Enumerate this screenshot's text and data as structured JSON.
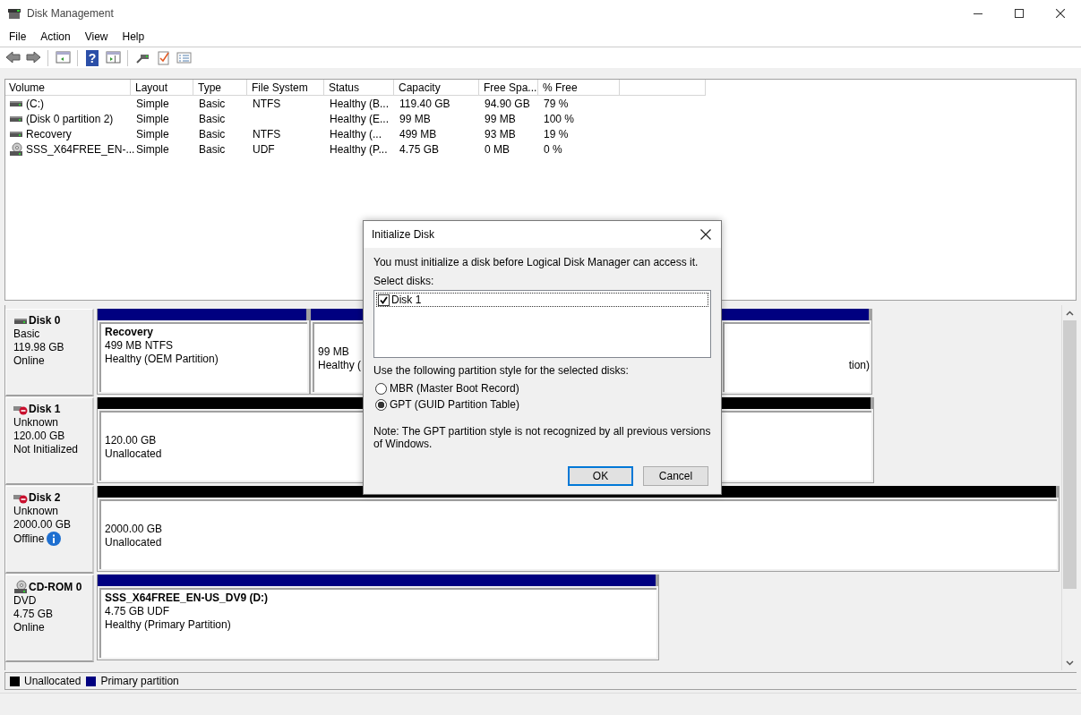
{
  "window": {
    "title": "Disk Management"
  },
  "toolbar": {
    "help_glyph": "?"
  },
  "menu": [
    "File",
    "Action",
    "View",
    "Help"
  ],
  "volumes": {
    "columns": [
      "Volume",
      "Layout",
      "Type",
      "File System",
      "Status",
      "Capacity",
      "Free Spa...",
      "% Free"
    ],
    "rows": [
      {
        "kind": "drive",
        "cells": [
          "(C:)",
          "Simple",
          "Basic",
          "NTFS",
          "Healthy (B...",
          "119.40 GB",
          "94.90 GB",
          "79 %"
        ]
      },
      {
        "kind": "drive",
        "cells": [
          "(Disk 0 partition 2)",
          "Simple",
          "Basic",
          "",
          "Healthy (E...",
          "99 MB",
          "99 MB",
          "100 %"
        ]
      },
      {
        "kind": "drive",
        "cells": [
          "Recovery",
          "Simple",
          "Basic",
          "NTFS",
          "Healthy (...",
          "499 MB",
          "93 MB",
          "19 %"
        ]
      },
      {
        "kind": "optical",
        "cells": [
          "SSS_X64FREE_EN-...",
          "Simple",
          "Basic",
          "UDF",
          "Healthy (P...",
          "4.75 GB",
          "0 MB",
          "0 %"
        ]
      }
    ]
  },
  "disks": [
    {
      "kind": "drive",
      "name": "Disk 0",
      "type": "Basic",
      "size": "119.98 GB",
      "state": "Online",
      "info": false,
      "partitions": [
        {
          "kind": "primary",
          "title": "Recovery",
          "lines": [
            "499 MB NTFS",
            "Healthy (OEM Partition)"
          ]
        },
        {
          "kind": "primary",
          "lines": [
            "99 MB",
            "Healthy ("
          ]
        },
        {
          "kind": "primary",
          "lines": [
            "tion)"
          ]
        }
      ]
    },
    {
      "kind": "drive_error",
      "name": "Disk 1",
      "type": "Unknown",
      "size": "120.00 GB",
      "state": "Not Initialized",
      "info": false,
      "partitions": [
        {
          "kind": "unallocated",
          "lines": [
            "120.00 GB",
            "Unallocated"
          ]
        }
      ]
    },
    {
      "kind": "drive_error",
      "name": "Disk 2",
      "type": "Unknown",
      "size": "2000.00 GB",
      "state": "Offline",
      "info": true,
      "partitions": [
        {
          "kind": "unallocated",
          "lines": [
            "2000.00 GB",
            "Unallocated"
          ]
        }
      ]
    },
    {
      "kind": "optical",
      "name": "CD-ROM 0",
      "type": "DVD",
      "size": "4.75 GB",
      "state": "Online",
      "info": false,
      "partitions": [
        {
          "kind": "primary",
          "title": "SSS_X64FREE_EN-US_DV9  (D:)",
          "lines": [
            "4.75 GB UDF",
            "Healthy (Primary Partition)"
          ]
        }
      ]
    }
  ],
  "legend": [
    {
      "kind": "unallocated",
      "label": "Unallocated"
    },
    {
      "kind": "primary",
      "label": "Primary partition"
    }
  ],
  "dialog": {
    "title": "Initialize Disk",
    "message": "You must initialize a disk before Logical Disk Manager can access it.",
    "select_label": "Select disks:",
    "disks": [
      {
        "label": "Disk 1",
        "checked": true,
        "selected": true
      }
    ],
    "style_label": "Use the following partition style for the selected disks:",
    "options": [
      {
        "label": "MBR (Master Boot Record)",
        "selected": false
      },
      {
        "label": "GPT (GUID Partition Table)",
        "selected": true
      }
    ],
    "note": "Note: The GPT partition style is not recognized by all previous versions of Windows.",
    "buttons": [
      {
        "label": "OK",
        "default": true
      },
      {
        "label": "Cancel",
        "default": false
      }
    ]
  }
}
